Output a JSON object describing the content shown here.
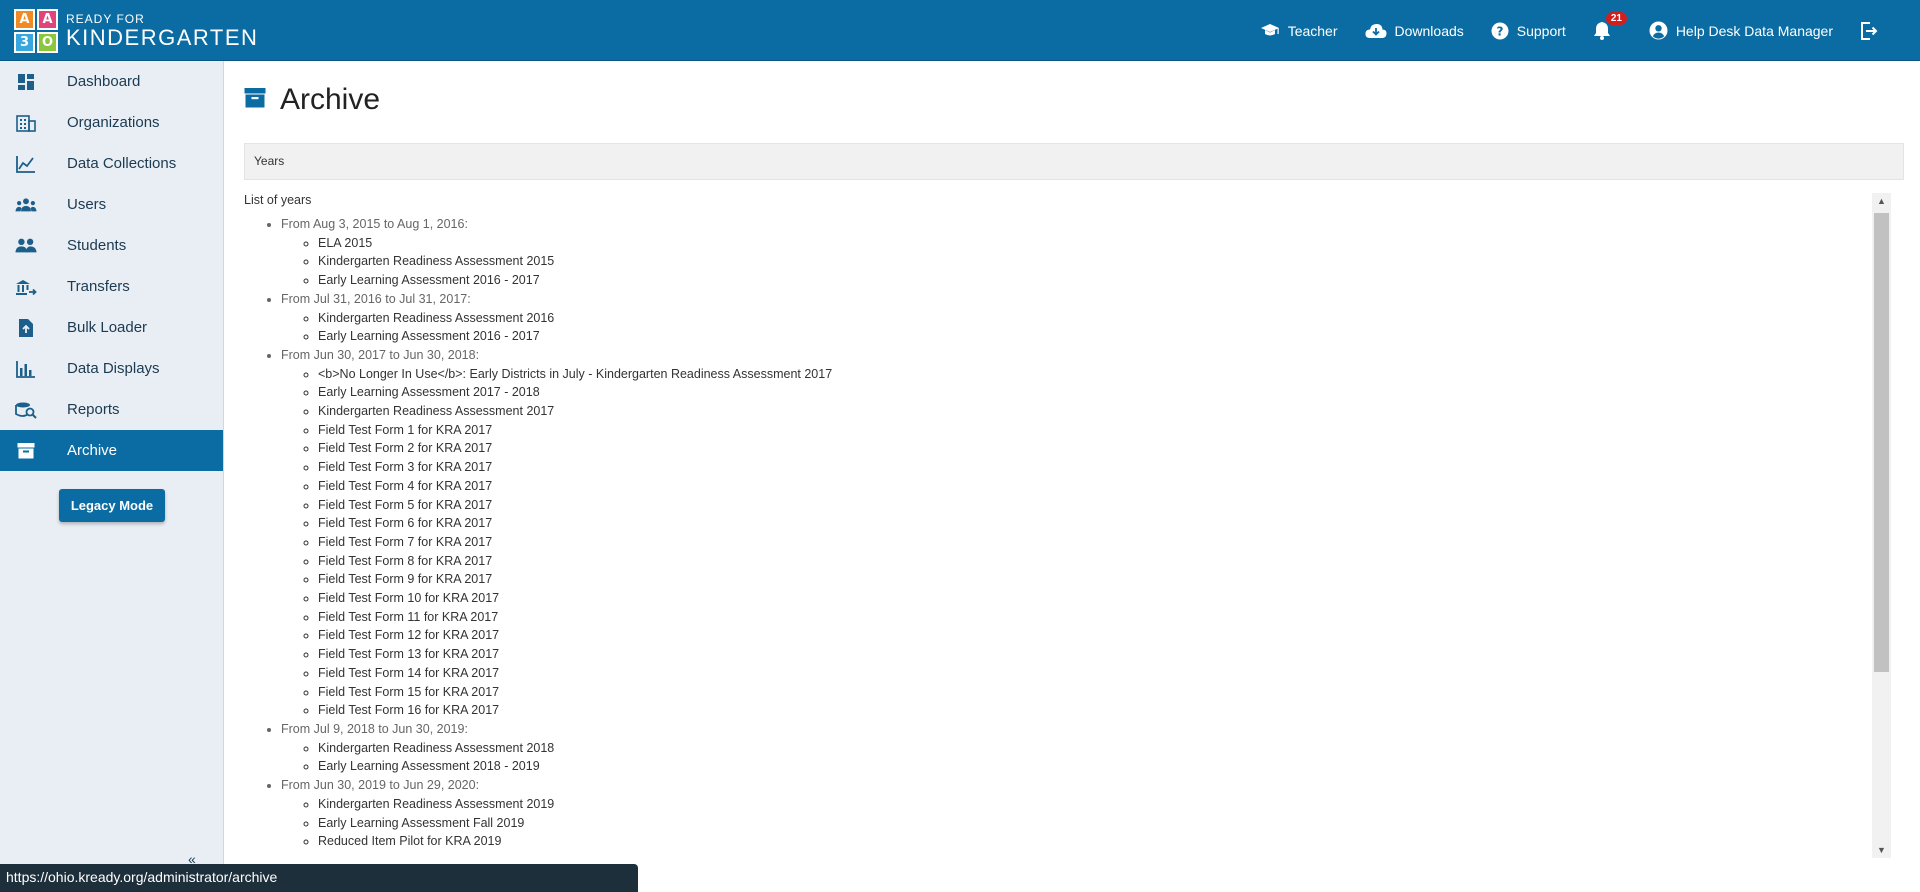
{
  "header": {
    "logo_small": "READY FOR",
    "logo_big": "KINDERGARTEN",
    "logo_blocks": [
      "A",
      "A",
      "3",
      "O"
    ],
    "nav": {
      "teacher": "Teacher",
      "downloads": "Downloads",
      "support": "Support",
      "notifications_count": "21",
      "user": "Help Desk Data Manager"
    }
  },
  "sidebar": {
    "items": [
      {
        "label": "Dashboard",
        "icon": "dashboard-icon"
      },
      {
        "label": "Organizations",
        "icon": "building-icon"
      },
      {
        "label": "Data Collections",
        "icon": "chart-line-icon"
      },
      {
        "label": "Users",
        "icon": "users-icon"
      },
      {
        "label": "Students",
        "icon": "students-icon"
      },
      {
        "label": "Transfers",
        "icon": "transfer-icon"
      },
      {
        "label": "Bulk Loader",
        "icon": "file-upload-icon"
      },
      {
        "label": "Data Displays",
        "icon": "bar-chart-icon"
      },
      {
        "label": "Reports",
        "icon": "report-search-icon"
      },
      {
        "label": "Archive",
        "icon": "archive-icon",
        "active": true
      }
    ],
    "legacy_button": "Legacy Mode",
    "collapse_glyph": "«"
  },
  "main": {
    "title": "Archive",
    "years_header": "Years",
    "list_heading": "List of years",
    "years": [
      {
        "range": "From Aug 3, 2015 to Aug 1, 2016:",
        "items": [
          "ELA 2015",
          "Kindergarten Readiness Assessment 2015",
          "Early Learning Assessment 2016 - 2017"
        ]
      },
      {
        "range": "From Jul 31, 2016 to Jul 31, 2017:",
        "items": [
          "Kindergarten Readiness Assessment 2016",
          "Early Learning Assessment 2016 - 2017"
        ]
      },
      {
        "range": "From Jun 30, 2017 to Jun 30, 2018:",
        "items": [
          "<b>No Longer In Use</b>: Early Districts in July - Kindergarten Readiness Assessment 2017",
          "Early Learning Assessment 2017 - 2018",
          "Kindergarten Readiness Assessment 2017",
          "Field Test Form 1 for KRA 2017",
          "Field Test Form 2 for KRA 2017",
          "Field Test Form 3 for KRA 2017",
          "Field Test Form 4 for KRA 2017",
          "Field Test Form 5 for KRA 2017",
          "Field Test Form 6 for KRA 2017",
          "Field Test Form 7 for KRA 2017",
          "Field Test Form 8 for KRA 2017",
          "Field Test Form 9 for KRA 2017",
          "Field Test Form 10 for KRA 2017",
          "Field Test Form 11 for KRA 2017",
          "Field Test Form 12 for KRA 2017",
          "Field Test Form 13 for KRA 2017",
          "Field Test Form 14 for KRA 2017",
          "Field Test Form 15 for KRA 2017",
          "Field Test Form 16 for KRA 2017"
        ]
      },
      {
        "range": "From Jul 9, 2018 to Jun 30, 2019:",
        "items": [
          "Kindergarten Readiness Assessment 2018",
          "Early Learning Assessment 2018 - 2019"
        ]
      },
      {
        "range": "From Jun 30, 2019 to Jun 29, 2020:",
        "items": [
          "Kindergarten Readiness Assessment 2019",
          "Early Learning Assessment Fall 2019",
          "Reduced Item Pilot for KRA 2019"
        ]
      }
    ]
  },
  "status_bar": {
    "url": "https://ohio.kready.org/administrator/archive"
  },
  "colors": {
    "brand": "#0a6ca3",
    "sidebar_bg": "#e8eef3",
    "badge": "#d01f1f"
  }
}
